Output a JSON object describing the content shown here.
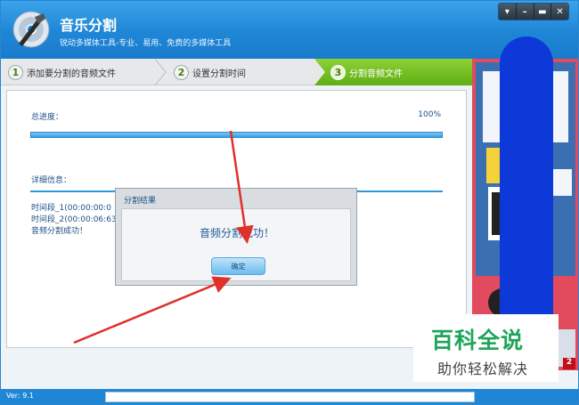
{
  "app": {
    "title": "音乐分割",
    "subtitle": "锐动多媒体工具-专业、易用、免费的多媒体工具"
  },
  "window_controls": [
    "▾",
    "–",
    "▬",
    "✕"
  ],
  "steps": [
    {
      "num": "1",
      "label": "添加要分割的音频文件"
    },
    {
      "num": "2",
      "label": "设置分割时间"
    },
    {
      "num": "3",
      "label": "分割音频文件"
    }
  ],
  "progress": {
    "label": "总进度：",
    "percent_text": "100%",
    "value": 1.0
  },
  "details": {
    "label": "详细信息：",
    "lines": [
      "时间段_1(00:00:00:0",
      "时间段_2(00:00:06:63",
      "音频分割成功！"
    ]
  },
  "dialog": {
    "title": "分割结果",
    "message": "音频分割成功！",
    "ok_label": "确定"
  },
  "status": {
    "version": "Ver: 9.1"
  },
  "ad": {
    "badge": "2"
  },
  "watermark": {
    "title": "百科全说",
    "subtitle": "助你轻松解决"
  },
  "colors": {
    "titlebar": "#1f86d6",
    "step_active": "#6cbf1e",
    "accent_text": "#1d4f86",
    "annotation_arrow": "#e0302a",
    "watermark_green": "#1ea55b"
  }
}
